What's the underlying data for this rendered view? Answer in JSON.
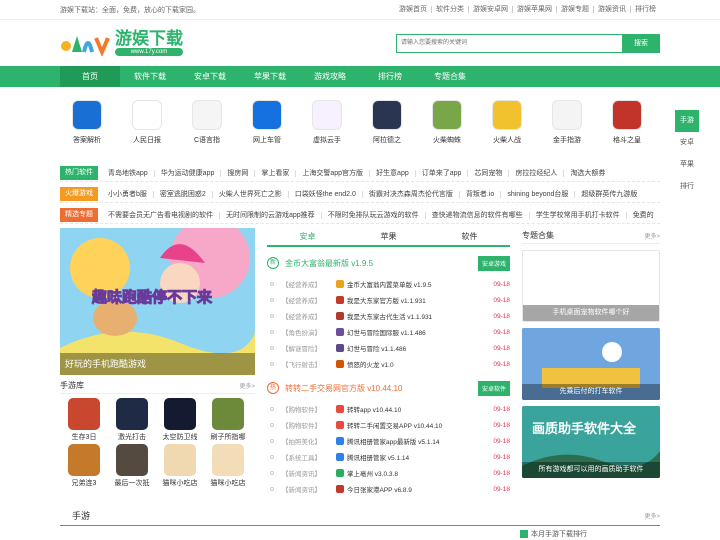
{
  "topbar": {
    "welcome": "游娱下载站：全面，免费，放心的下载家园。",
    "links": [
      "游娱首页",
      "软件分类",
      "游娱安卓网",
      "游娱苹果网",
      "游娱专题",
      "游娱资讯",
      "排行榜"
    ]
  },
  "header": {
    "logo_title": "游娱下载",
    "logo_url": "www.17y.com",
    "search_placeholder": "请输入您要搜索的关键词",
    "search_button": "搜索"
  },
  "nav": [
    "首页",
    "软件下载",
    "安卓下载",
    "苹果下载",
    "游戏攻略",
    "排行榜",
    "专题合集"
  ],
  "apps": [
    {
      "label": "答案解析",
      "color": "#1a6fd4"
    },
    {
      "label": "人民日报",
      "color": "#ffffff"
    },
    {
      "label": "C语言指",
      "color": "#f5f5f5"
    },
    {
      "label": "网上车管",
      "color": "#1570e0"
    },
    {
      "label": "虚拟云手",
      "color": "#f7f0ff"
    },
    {
      "label": "阿拉德之",
      "color": "#2a3552"
    },
    {
      "label": "火柴蜘蛛",
      "color": "#7aa64a"
    },
    {
      "label": "火柴人战",
      "color": "#f1c22d"
    },
    {
      "label": "金手指游",
      "color": "#f4f4f4"
    },
    {
      "label": "格斗之皇",
      "color": "#c2342a"
    }
  ],
  "sidetabs": [
    "手游",
    "安卓",
    "苹果",
    "排行"
  ],
  "tagrows": [
    {
      "label": "热门软件",
      "color": "#2db36b",
      "items": [
        "青岛地铁app",
        "华为运动健康app",
        "搜房网",
        "掌上看家",
        "上海交警app官方版",
        "好生意app",
        "订单来了app",
        "芯同宠物",
        "房拉拉经纪人",
        "淘选大额券"
      ]
    },
    {
      "label": "火爆游戏",
      "color": "#f39a1f",
      "items": [
        "小小勇者b服",
        "密室逃脱困惑2",
        "火柴人世界死亡之影",
        "口袋妖怪the end2.0",
        "街霸对决杰森周杰伦代言版",
        "背叛者.io",
        "shining beyond台服",
        "超级群英传九游版"
      ]
    },
    {
      "label": "精选专题",
      "color": "#f06d32",
      "items": [
        "不需要会员无广告看电视剧的软件",
        "无时间限制的云游戏app推荐",
        "不限时免排队玩云游戏的软件",
        "查快递物流信息的软件有哪些",
        "学生学校常用手机打卡软件",
        "免费的"
      ]
    }
  ],
  "banner": {
    "caption": "好玩的手机跑酷游戏",
    "art_text": "趣味跑酷停不下来"
  },
  "games": {
    "title": "手游库",
    "more": "更多>",
    "items": [
      {
        "label": "生存3日",
        "color": "#c9472f"
      },
      {
        "label": "激光打击",
        "color": "#1f2a44"
      },
      {
        "label": "太空防卫线",
        "color": "#141a30"
      },
      {
        "label": "刷子所指哪",
        "color": "#6c8a3a"
      },
      {
        "label": "兄弟连3",
        "color": "#c47a2a"
      },
      {
        "label": "最后一次抵",
        "color": "#544a3f"
      },
      {
        "label": "猫咪小吃店",
        "color": "#f0d8b0"
      },
      {
        "label": "猫咪小吃店",
        "color": "#f3dcb8"
      }
    ]
  },
  "middle": {
    "tabs": [
      "安卓",
      "苹果",
      "软件"
    ],
    "sections": [
      {
        "badge": "新",
        "title": "金币大富翁最新版 v1.9.5",
        "button": "安卓游戏",
        "rows": [
          {
            "cat": "【经营养成】",
            "name": "金币大富翁内置菜单版 v1.9.5",
            "date": "09-18",
            "color": "#e8a51a"
          },
          {
            "cat": "【经营养成】",
            "name": "我是大东家官方版 v1.1.931",
            "date": "09-18",
            "color": "#c0392b"
          },
          {
            "cat": "【经营养成】",
            "name": "我是大东家古代生活 v1.1.931",
            "date": "09-18",
            "color": "#b03a2e"
          },
          {
            "cat": "【角色扮演】",
            "name": "幻世与冒险国际服 v1.1.486",
            "date": "09-18",
            "color": "#6d4c9a"
          },
          {
            "cat": "【解谜冒险】",
            "name": "幻世与冒险 v1.1.486",
            "date": "09-18",
            "color": "#5a4a8a"
          },
          {
            "cat": "【飞行射击】",
            "name": "愤怒的火龙 v1.0",
            "date": "09-18",
            "color": "#d35400"
          }
        ]
      },
      {
        "badge": "热",
        "title": "转转二手交易网官方版 v10.44.10",
        "button": "安卓软件",
        "rows": [
          {
            "cat": "【购物软件】",
            "name": "转转app v10.44.10",
            "date": "09-18",
            "color": "#e74c3c"
          },
          {
            "cat": "【购物软件】",
            "name": "转转二手闲置交易APP v10.44.10",
            "date": "09-18",
            "color": "#e74c3c"
          },
          {
            "cat": "【拍照美化】",
            "name": "腾讯相册管家app最新版 v5.1.14",
            "date": "09-18",
            "color": "#2f80ed"
          },
          {
            "cat": "【系统工具】",
            "name": "腾讯相册管家 v5.1.14",
            "date": "09-18",
            "color": "#2f80ed"
          },
          {
            "cat": "【新闻资讯】",
            "name": "掌上亳州 v3.0.3.8",
            "date": "09-18",
            "color": "#27ae60"
          },
          {
            "cat": "【新闻资讯】",
            "name": "今日张家港APP v6.8.9",
            "date": "09-18",
            "color": "#c0392b"
          }
        ]
      }
    ]
  },
  "topics": {
    "title": "专题合集",
    "more": "更多>",
    "items": [
      {
        "caption": "手机桌面宠物软件哪个好",
        "color": "#ffffff"
      },
      {
        "caption": "先乘后付的打车软件",
        "color": "#5b8fd4"
      },
      {
        "caption": "所有游戏都可以用的画质助手软件",
        "color": "#3aa39b",
        "art_text": "画质助手软件大全"
      }
    ]
  },
  "bottom": {
    "title": "手游",
    "more": "更多>",
    "rank": "本月手游下载排行"
  }
}
